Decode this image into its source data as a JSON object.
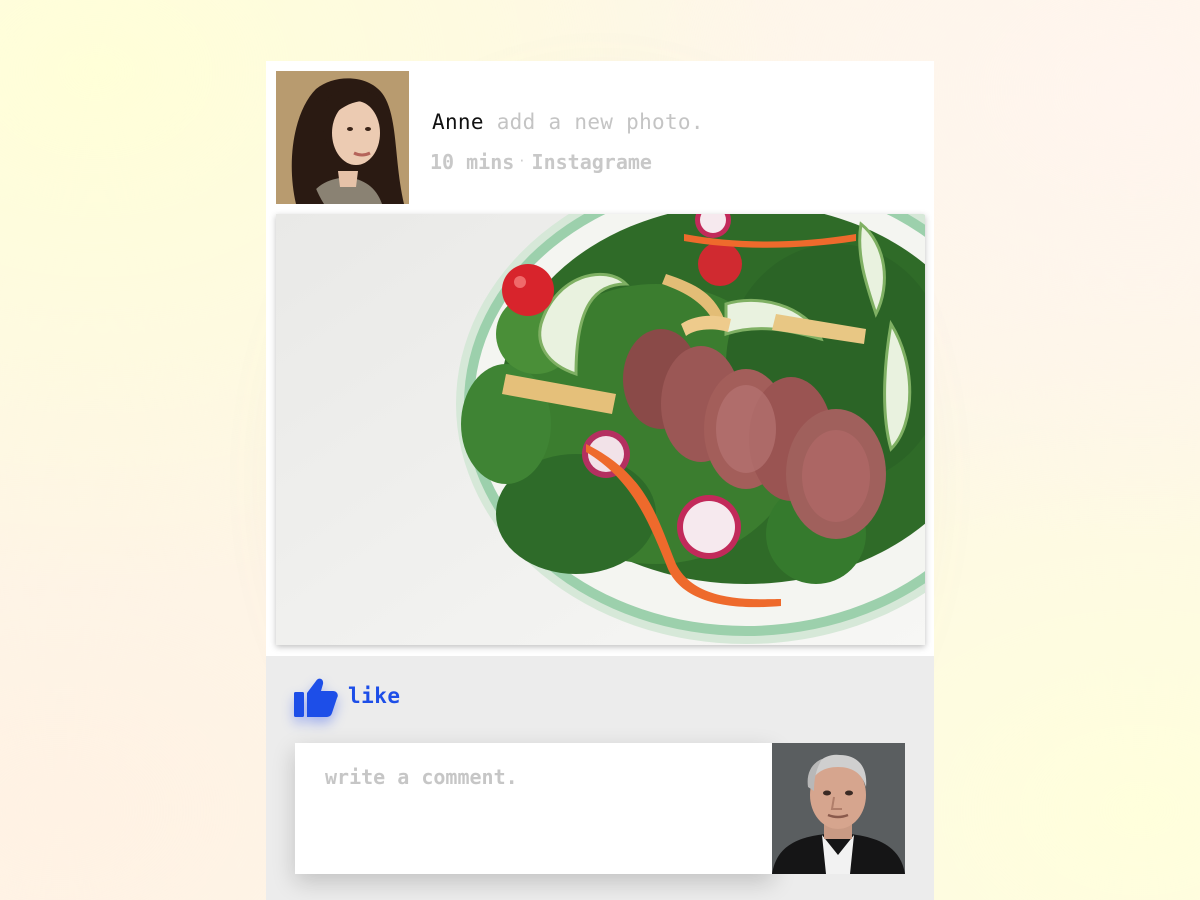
{
  "post": {
    "author_name": "Anne",
    "action_text": "add a new photo.",
    "time_ago": "10 mins",
    "separator": "·",
    "source": "Instagrame"
  },
  "actions": {
    "like_label": "like",
    "like_icon": "thumbs-up-icon"
  },
  "comment": {
    "placeholder": "write a comment."
  },
  "colors": {
    "accent": "#1d4ee8",
    "blue_bar": "#1447e6",
    "muted_text": "#c4c4c4",
    "actions_bg": "#ececec"
  }
}
